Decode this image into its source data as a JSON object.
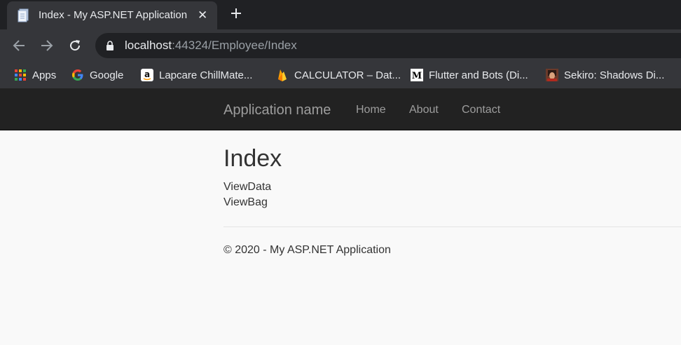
{
  "browser": {
    "tab": {
      "title": "Index - My ASP.NET Application",
      "close": "✕"
    },
    "address": {
      "host": "localhost",
      "rest": ":44324/Employee/Index"
    },
    "bookmarks": [
      {
        "label": "Apps",
        "icon": "apps-grid-icon"
      },
      {
        "label": "Google",
        "icon": "google-icon"
      },
      {
        "label": "Lapcare ChillMate...",
        "icon": "amazon-icon"
      },
      {
        "label": "CALCULATOR – Dat...",
        "icon": "firebase-icon"
      },
      {
        "label": "Flutter and Bots (Di...",
        "icon": "medium-icon"
      },
      {
        "label": "Sekiro: Shadows Di...",
        "icon": "sekiro-thumbnail-icon"
      }
    ]
  },
  "navbar": {
    "brand": "Application name",
    "links": [
      "Home",
      "About",
      "Contact"
    ]
  },
  "main": {
    "title": "Index",
    "lines": [
      "ViewData",
      "ViewBag"
    ]
  },
  "footer": {
    "text": "© 2020 - My ASP.NET Application"
  },
  "colors": {
    "tabstrip": "#202124",
    "toolbar": "#35363a",
    "navbar": "#222222",
    "navlink": "#9d9d9d",
    "page_bg": "#f9f9f9"
  }
}
